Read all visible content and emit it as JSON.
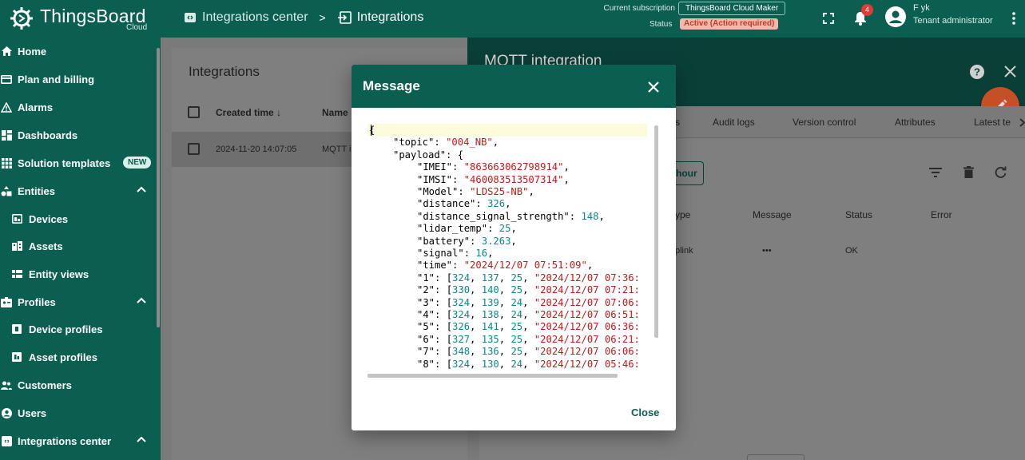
{
  "app": {
    "logo_text": "ThingsBoard",
    "logo_sub": "Cloud"
  },
  "breadcrumbs": [
    {
      "label": "Integrations center"
    },
    {
      "label": "Integrations"
    }
  ],
  "breadcrumb_separator": ">",
  "subscription": {
    "label": "Current subscription",
    "plan": "ThingsBoard Cloud Maker",
    "status_label": "Status",
    "status_value": "Active (Action required)"
  },
  "notifications_count": "4",
  "user": {
    "name": "F yk",
    "role": "Tenant administrator"
  },
  "sidebar": {
    "items": [
      {
        "label": "Home",
        "icon": "home-icon"
      },
      {
        "label": "Plan and billing",
        "icon": "billing-icon"
      },
      {
        "label": "Alarms",
        "icon": "alarm-icon"
      },
      {
        "label": "Dashboards",
        "icon": "dashboard-icon"
      },
      {
        "label": "Solution templates",
        "icon": "grid-icon",
        "badge": "NEW"
      },
      {
        "label": "Entities",
        "icon": "entities-icon",
        "expanded": true
      },
      {
        "label": "Devices",
        "icon": "device-icon"
      },
      {
        "label": "Assets",
        "icon": "asset-icon"
      },
      {
        "label": "Entity views",
        "icon": "entity-view-icon"
      },
      {
        "label": "Profiles",
        "icon": "profiles-icon",
        "expanded": true
      },
      {
        "label": "Device profiles",
        "icon": "device-profile-icon"
      },
      {
        "label": "Asset profiles",
        "icon": "asset-profile-icon"
      },
      {
        "label": "Customers",
        "icon": "customers-icon"
      },
      {
        "label": "Users",
        "icon": "users-icon"
      },
      {
        "label": "Integrations center",
        "icon": "integrations-icon",
        "expanded": true
      }
    ]
  },
  "integrations_list": {
    "title": "Integrations",
    "columns": [
      "Created time",
      "Name"
    ],
    "rows": [
      {
        "created": "2024-11-20 14:07:05",
        "name": "MQTT i"
      }
    ]
  },
  "detail": {
    "title": "MQTT integration",
    "tabs": [
      "s",
      "Audit logs",
      "Version control",
      "Attributes",
      "Latest te"
    ],
    "interval_button": "hour",
    "columns": [
      "ype",
      "Message",
      "Status",
      "Error"
    ],
    "row": {
      "type": "plink",
      "message": "•••",
      "status": "OK",
      "error": ""
    }
  },
  "dialog": {
    "title": "Message",
    "close_label": "Close",
    "json_lines": [
      "{",
      "\"topic\": \"004_NB\",",
      "\"payload\": {",
      "\"IMEI\": \"863663062798914\",",
      "\"IMSI\": \"460083513507314\",",
      "\"Model\": \"LDS25-NB\",",
      "\"distance\": 326,",
      "\"distance_signal_strength\": 148,",
      "\"lidar_temp\": 25,",
      "\"battery\": 3.263,",
      "\"signal\": 16,",
      "\"time\": \"2024/12/07 07:51:09\",",
      "\"1\": [324, 137, 25, \"2024/12/07 07:36:",
      "\"2\": [330, 140, 25, \"2024/12/07 07:21:",
      "\"3\": [324, 139, 24, \"2024/12/07 07:06:",
      "\"4\": [324, 138, 24, \"2024/12/07 06:51:",
      "\"5\": [326, 141, 25, \"2024/12/07 06:36:",
      "\"6\": [327, 135, 25, \"2024/12/07 06:21:",
      "\"7\": [348, 136, 25, \"2024/12/07 06:06:",
      "\"8\": [324, 130, 24, \"2024/12/07 05:46:"
    ]
  },
  "colors": {
    "primary": "#0a5f51",
    "accent_fab": "#c54f26",
    "json_string": "#c41a16",
    "json_number": "#098a8a",
    "status_badge_text": "#c0392b"
  }
}
